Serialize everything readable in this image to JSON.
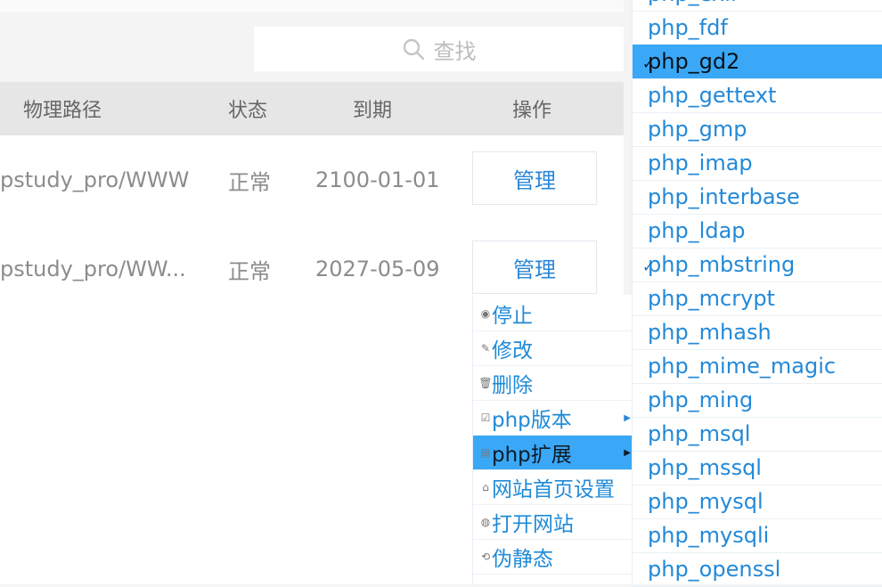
{
  "search": {
    "placeholder": "查找"
  },
  "table": {
    "headers": {
      "path": "物理路径",
      "status": "状态",
      "expire": "到期",
      "action": "操作"
    },
    "rows": [
      {
        "path": "pstudy_pro/WWW",
        "status": "正常",
        "expire": "2100-01-01",
        "action": "管理"
      },
      {
        "path": "pstudy_pro/WW...",
        "status": "正常",
        "expire": "2027-05-09",
        "action": "管理"
      }
    ]
  },
  "context_menu": {
    "items": [
      {
        "label": "停止",
        "icon": "stop-icon"
      },
      {
        "label": "修改",
        "icon": "edit-icon"
      },
      {
        "label": "删除",
        "icon": "trash-icon"
      },
      {
        "label": "php版本",
        "icon": "version-icon",
        "submenu": true
      },
      {
        "label": "php扩展",
        "icon": "extension-icon",
        "submenu": true,
        "active": true
      },
      {
        "label": "网站首页设置",
        "icon": "home-icon"
      },
      {
        "label": "打开网站",
        "icon": "globe-icon"
      },
      {
        "label": "伪静态",
        "icon": "rewrite-icon"
      }
    ]
  },
  "extensions": {
    "items": [
      {
        "label": "php_exif",
        "checked": false
      },
      {
        "label": "php_fdf",
        "checked": false
      },
      {
        "label": "php_gd2",
        "checked": true,
        "active": true
      },
      {
        "label": "php_gettext",
        "checked": false
      },
      {
        "label": "php_gmp",
        "checked": false
      },
      {
        "label": "php_imap",
        "checked": false
      },
      {
        "label": "php_interbase",
        "checked": false
      },
      {
        "label": "php_ldap",
        "checked": false
      },
      {
        "label": "php_mbstring",
        "checked": true
      },
      {
        "label": "php_mcrypt",
        "checked": false
      },
      {
        "label": "php_mhash",
        "checked": false
      },
      {
        "label": "php_mime_magic",
        "checked": false
      },
      {
        "label": "php_ming",
        "checked": false
      },
      {
        "label": "php_msql",
        "checked": false
      },
      {
        "label": "php_mssql",
        "checked": false
      },
      {
        "label": "php_mysql",
        "checked": false
      },
      {
        "label": "php_mysqli",
        "checked": false
      },
      {
        "label": "php_openssl",
        "checked": false
      }
    ]
  },
  "colors": {
    "accent": "#3aa8f6",
    "link": "#2389d8"
  }
}
